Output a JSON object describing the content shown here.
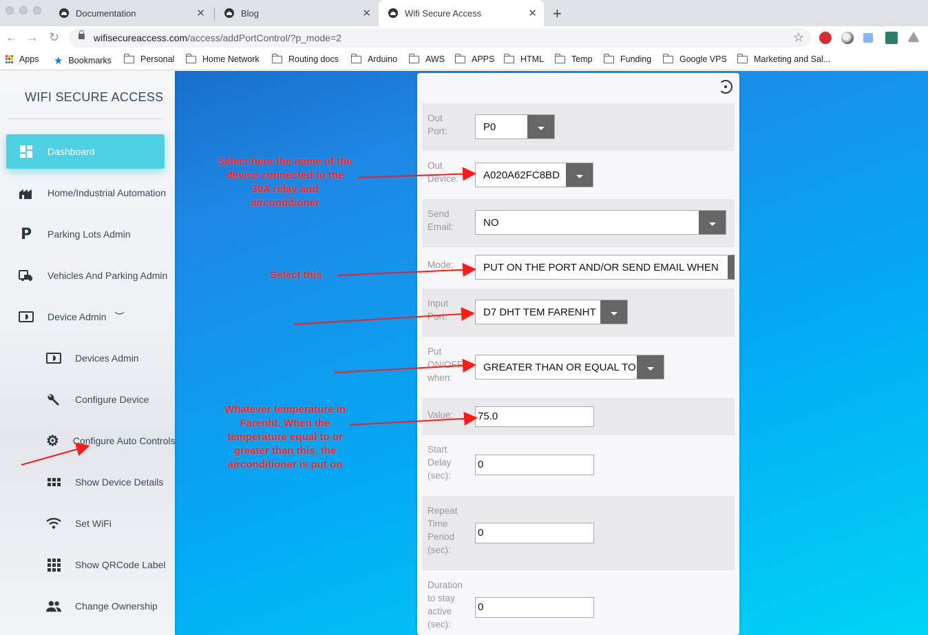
{
  "browser": {
    "tabs": [
      {
        "title": "Documentation"
      },
      {
        "title": "Blog"
      },
      {
        "title": "Wifi Secure Access"
      }
    ],
    "url_host": "wifisecureaccess.com",
    "url_path": "/access/addPortControl/?p_mode=2",
    "bookmarks": [
      "Apps",
      "Bookmarks",
      "Personal",
      "Home Network",
      "Routing docs",
      "Arduino",
      "AWS",
      "APPS",
      "HTML",
      "Temp",
      "Funding",
      "Google VPS",
      "Marketing and Sal..."
    ]
  },
  "sidebar": {
    "brand": "WIFI SECURE ACCESS",
    "items": [
      {
        "label": "Dashboard",
        "icon": "dashboard-icon"
      },
      {
        "label": "Home/Industrial Automation",
        "icon": "factory-icon"
      },
      {
        "label": "Parking Lots Admin",
        "icon": "parking-icon"
      },
      {
        "label": "Vehicles And Parking Admin",
        "icon": "vehicle-icon"
      },
      {
        "label": "Device Admin",
        "icon": "device-icon"
      },
      {
        "label": "Devices Admin",
        "icon": "device-icon"
      },
      {
        "label": "Configure Device",
        "icon": "wrench-icon"
      },
      {
        "label": "Configure Auto Controls",
        "icon": "gear-icon"
      },
      {
        "label": "Show Device Details",
        "icon": "grid-icon"
      },
      {
        "label": "Set WiFi",
        "icon": "wifi-icon"
      },
      {
        "label": "Show QRCode Label",
        "icon": "qrcode-icon"
      },
      {
        "label": "Change Ownership",
        "icon": "people-icon"
      }
    ]
  },
  "form": {
    "out_port": {
      "label": "Out Port:",
      "value": "P0"
    },
    "out_device": {
      "label": "Out Device:",
      "value": "A020A62FC8BD"
    },
    "send_email": {
      "label": "Send Email:",
      "value": "NO"
    },
    "mode": {
      "label": "Mode:",
      "value": "PUT ON THE PORT AND/OR SEND EMAIL WHEN"
    },
    "input_port": {
      "label": "Input Port:",
      "value": "D7 DHT TEM FARENHT"
    },
    "put_on_off": {
      "label": "Put ON/OFF when:",
      "value": "GREATER THAN OR EQUAL TO"
    },
    "value": {
      "label": "Value:",
      "value": "75.0"
    },
    "start_delay": {
      "label": "Start Delay (sec):",
      "value": "0"
    },
    "repeat_time": {
      "label": "Repeat Time Period (sec):",
      "value": "0"
    },
    "duration": {
      "label": "Duration to stay active (sec):",
      "value": "0"
    }
  },
  "annotations": {
    "device_note": "Select here the name of the device connected to the 30A relay and airconditioner",
    "mode_note": "Select this",
    "value_note": "Whatever temperature in Farenht.  When the temperature equal to or greater than this, the airconditioner is put on"
  },
  "colors": {
    "annotation": "#ff1a1a",
    "active_nav": "#4dd0e1"
  }
}
